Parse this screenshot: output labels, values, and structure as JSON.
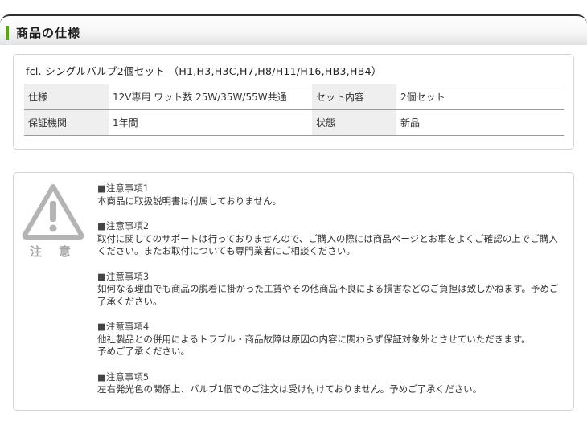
{
  "header": {
    "title": "商品の仕様",
    "accent_color": "#57a02c"
  },
  "spec": {
    "product_name": "fcl. シングルバルブ2個セット （H1,H3,H3C,H7,H8/H11/H16,HB3,HB4）",
    "rows": [
      {
        "label1": "仕様",
        "value1": "12V専用 ワット数 25W/35W/55W共通",
        "label2": "セット内容",
        "value2": "2個セット"
      },
      {
        "label1": "保証機関",
        "value1": "1年間",
        "label2": "状態",
        "value2": "新品"
      }
    ]
  },
  "notice": {
    "icon": "warning-triangle-icon",
    "label": "注意",
    "items": [
      {
        "title": "■注意事項1",
        "body": "本商品に取扱説明書は付属しておりません。"
      },
      {
        "title": "■注意事項2",
        "body": "取付に関してのサポートは行っておりませんので、ご購入の際には商品ページとお車をよくご確認の上でご購入ください。またお取付についても専門業者にご相談ください。"
      },
      {
        "title": "■注意事項3",
        "body": "如何なる理由でも商品の脱着に掛かった工賃やその他商品不良による損害などのご負担は致しかねます。予めご了承ください。"
      },
      {
        "title": "■注意事項4",
        "body": "他社製品との併用によるトラブル・商品故障は原因の内容に関わらず保証対象外とさせていただきます。\n予めご了承ください。"
      },
      {
        "title": "■注意事項5",
        "body": "左右発光色の関係上、バルブ1個でのご注文は受け付けておりません。予めご了承ください。"
      }
    ]
  }
}
